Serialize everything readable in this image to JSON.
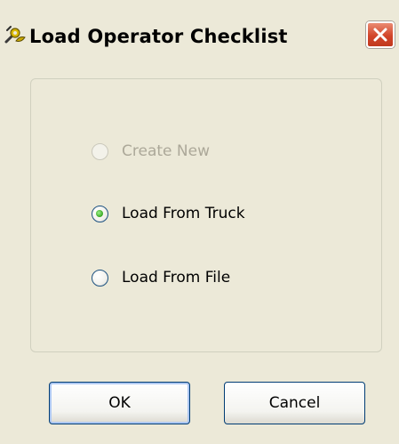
{
  "window": {
    "title": "Load Operator Checklist",
    "icon": "checklist-wrench-icon",
    "close_icon": "close-icon",
    "close_color": "#d2452a"
  },
  "options": [
    {
      "label": "Create New",
      "selected": false,
      "enabled": false
    },
    {
      "label": "Load From Truck",
      "selected": true,
      "enabled": true
    },
    {
      "label": "Load From File",
      "selected": false,
      "enabled": true
    }
  ],
  "buttons": {
    "ok": "OK",
    "cancel": "Cancel"
  },
  "colors": {
    "window_bg": "#ece9d8",
    "disabled_text": "#aca899",
    "radio_selected": "#36a620",
    "button_border": "#003c74"
  }
}
